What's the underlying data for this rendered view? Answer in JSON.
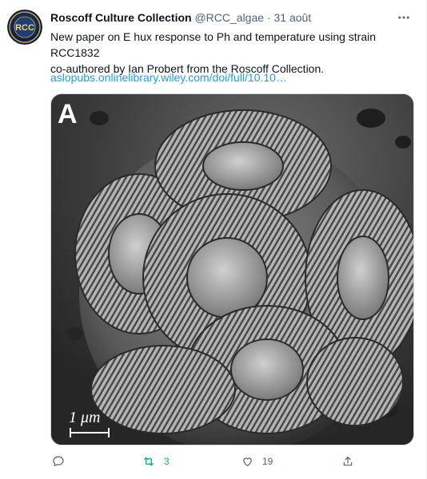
{
  "author": {
    "display_name": "Roscoff Culture Collection",
    "handle": "@RCC_algae",
    "separator": "·",
    "date": "31 août",
    "avatar_text": "RCC"
  },
  "tweet": {
    "text": "New paper on E hux response to Ph and temperature using strain RCC1832\nco-authored by Ian Probert from the Roscoff Collection.",
    "link": "aslopubs.onlinelibrary.wiley.com/doi/full/10.10…"
  },
  "media": {
    "panel_label": "A",
    "scale_label": "1 μm"
  },
  "actions": {
    "reply_count": "",
    "retweet_count": "3",
    "like_count": "19"
  },
  "icons": {
    "more": "more-dots-icon",
    "reply": "reply-bubble-icon",
    "retweet": "retweet-icon",
    "like": "heart-icon",
    "share": "share-icon"
  },
  "colors": {
    "link": "#1d9bf0",
    "muted": "#536471",
    "retweet_active": "#00ba7c"
  }
}
